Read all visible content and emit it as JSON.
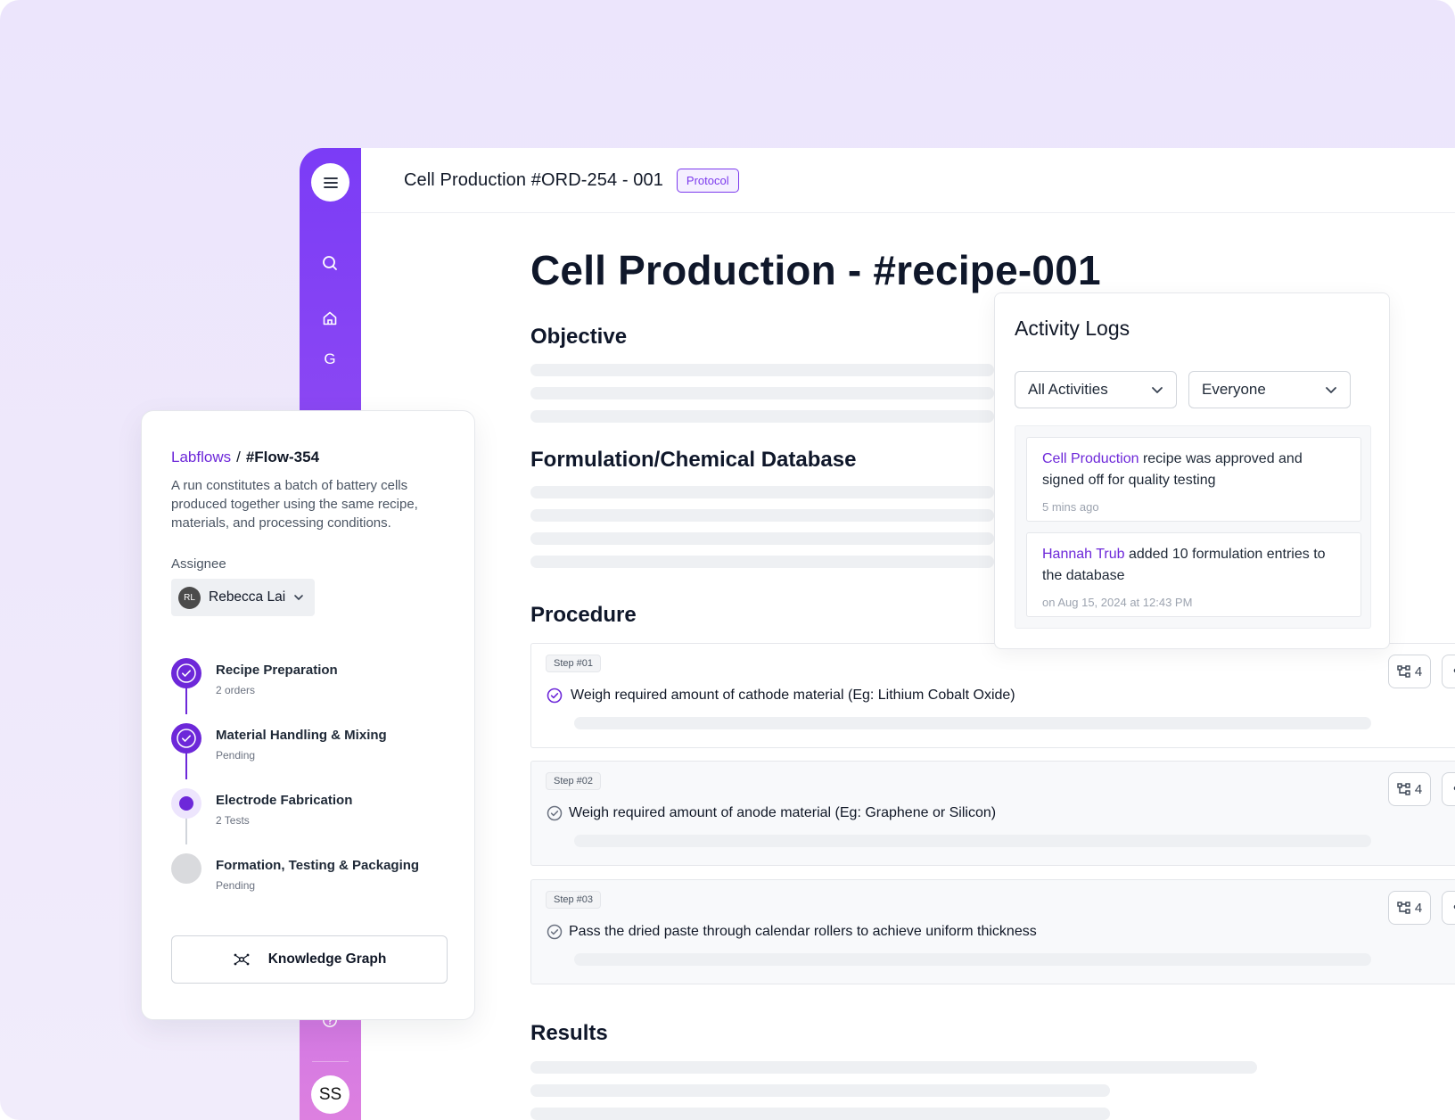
{
  "header": {
    "title": "Cell Production #ORD-254 - 001",
    "badge": "Protocol"
  },
  "sidebar": {
    "letter": "G",
    "user_initials": "SS"
  },
  "main": {
    "title": "Cell Production - #recipe-001",
    "sections": {
      "objective": "Objective",
      "formulation": "Formulation/Chemical Database",
      "procedure": "Procedure",
      "results": "Results"
    },
    "steps": [
      {
        "tag": "Step #01",
        "text": "Weigh required amount of cathode material (Eg: Lithium Cobalt Oxide)",
        "count": "4",
        "status": "done"
      },
      {
        "tag": "Step #02",
        "text": "Weigh required amount of anode material (Eg: Graphene or Silicon)",
        "count": "4",
        "status": "pending"
      },
      {
        "tag": "Step #03",
        "text": "Pass the dried paste through calendar rollers to achieve uniform thickness",
        "count": "4",
        "status": "pending"
      }
    ]
  },
  "activity": {
    "title": "Activity Logs",
    "filter_activity": "All Activities",
    "filter_people": "Everyone",
    "logs": [
      {
        "link": "Cell Production",
        "text": " recipe was approved and signed off for quality testing",
        "time": "5 mins ago"
      },
      {
        "link": "Hannah Trub",
        "text": " added 10 formulation entries to the database",
        "time": "on Aug 15, 2024 at 12:43 PM"
      }
    ]
  },
  "flow": {
    "crumb_root": "Labflows",
    "crumb_sep": "/",
    "crumb_current": "#Flow-354",
    "description": "A run constitutes a batch of battery cells produced together using the same recipe, materials, and processing conditions.",
    "assignee_label": "Assignee",
    "assignee_initials": "RL",
    "assignee_name": "Rebecca Lai",
    "stages": [
      {
        "title": "Recipe Preparation",
        "sub": "2 orders",
        "state": "complete"
      },
      {
        "title": "Material Handling & Mixing",
        "sub": "Pending",
        "state": "complete"
      },
      {
        "title": "Electrode Fabrication",
        "sub": "2 Tests",
        "state": "active"
      },
      {
        "title": "Formation, Testing & Packaging",
        "sub": "Pending",
        "state": "todo"
      }
    ],
    "kg_button": "Knowledge Graph"
  },
  "colors": {
    "accent": "#7c3aed",
    "background": "#ede6fb",
    "rail_top": "#7b3cf6",
    "rail_bottom": "#dd80e0"
  },
  "icons": [
    "menu-icon",
    "search-icon",
    "home-icon",
    "help-icon",
    "check-circle-icon",
    "chevron-down-icon",
    "flow-icon",
    "more-icon",
    "graph-icon"
  ]
}
